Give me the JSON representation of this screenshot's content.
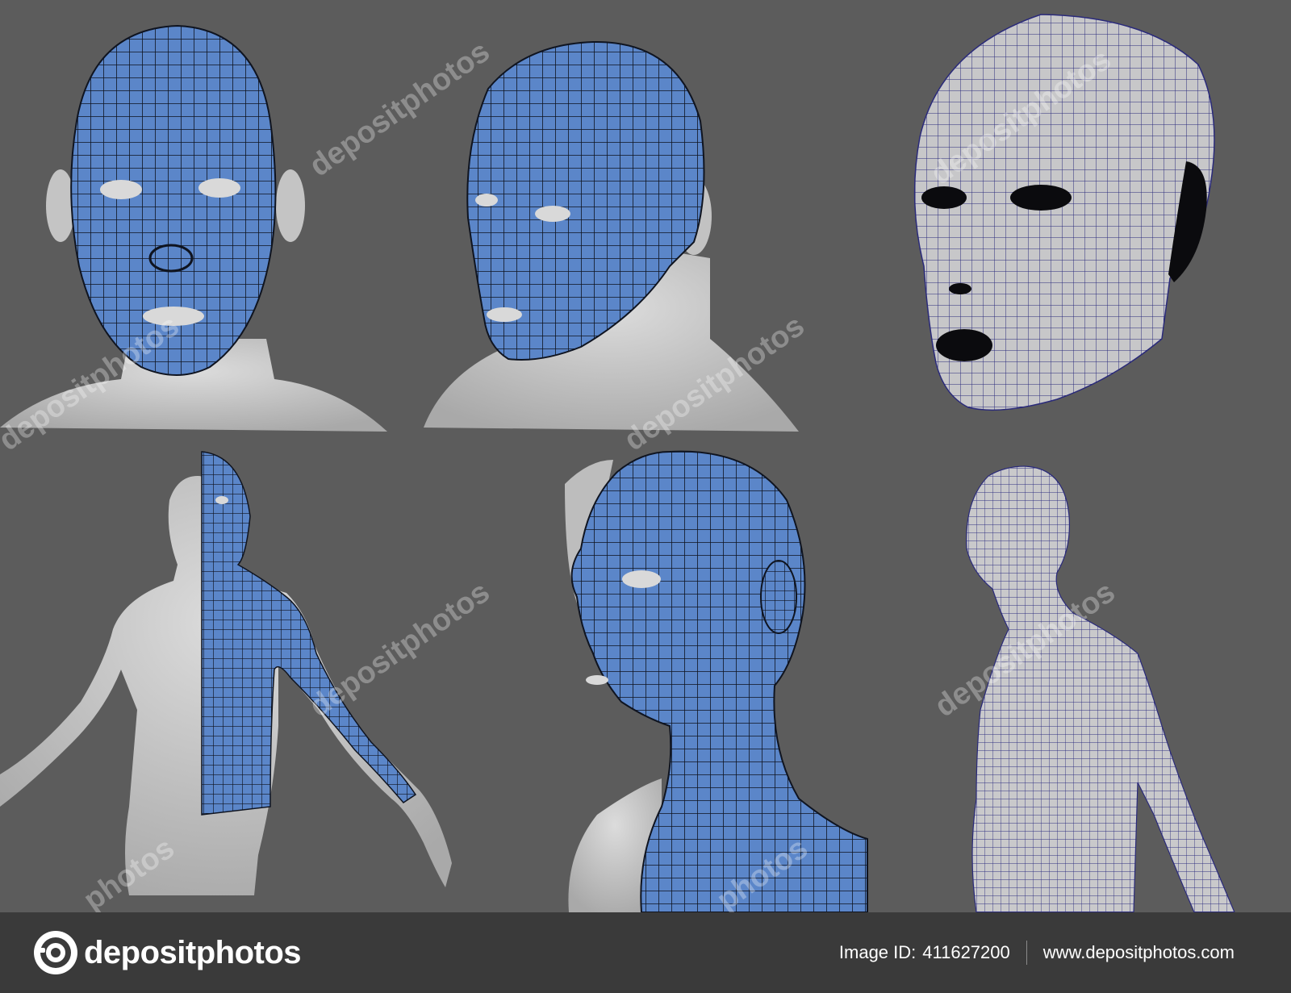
{
  "watermark": {
    "text": "depositphotos",
    "partial_text": "photos"
  },
  "footer": {
    "brand_name": "depositphotos",
    "image_id_label": "Image ID:",
    "image_id": "411627200",
    "website": "www.depositphotos.com"
  },
  "colors": {
    "background": "#5c5c5c",
    "mesh_fill": "#5b86c9",
    "mesh_line": "#0f1420",
    "skin": "#c9c9c9",
    "wire_line": "#2a2a7a",
    "footer_bg": "#3a3a3a"
  },
  "panels": [
    {
      "id": "front-face-mesh",
      "style": "blue-mesh"
    },
    {
      "id": "three-quarter-face-mesh",
      "style": "blue-mesh"
    },
    {
      "id": "face-shell-wireframe",
      "style": "wireframe"
    },
    {
      "id": "half-body-mesh",
      "style": "blue-mesh"
    },
    {
      "id": "head-side-mesh",
      "style": "blue-mesh"
    },
    {
      "id": "torso-wireframe",
      "style": "wireframe"
    }
  ]
}
